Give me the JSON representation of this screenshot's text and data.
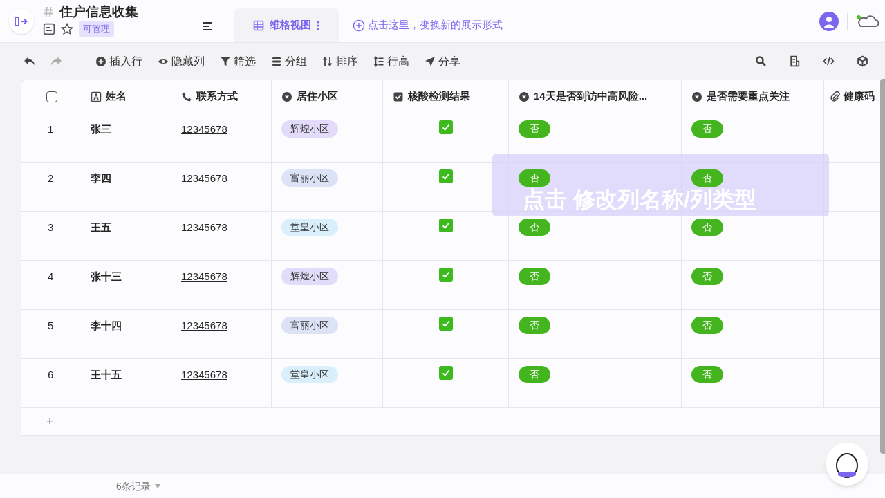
{
  "header": {
    "title": "住户信息收集",
    "permission": "可管理",
    "view_tab": {
      "label": "维格视图",
      "selected": true
    },
    "view_hint": "点击这里，变换新的展示形式"
  },
  "toolbar": [
    "插入行",
    "隐藏列",
    "筛选",
    "分组",
    "排序",
    "行高",
    "分享"
  ],
  "table": {
    "columns": [
      {
        "label": "姓名",
        "kind": "text"
      },
      {
        "label": "联系方式",
        "kind": "phone"
      },
      {
        "label": "居住小区",
        "kind": "select"
      },
      {
        "label": "核酸检测结果",
        "kind": "checkbox"
      },
      {
        "label": "14天是否到访中高风险...",
        "kind": "select"
      },
      {
        "label": "是否需要重点关注",
        "kind": "select"
      },
      {
        "label": "健康码",
        "kind": "attachment"
      }
    ],
    "rows": [
      {
        "index": "1",
        "name": "张三",
        "phone": "12345678",
        "community": {
          "text": "辉煌小区",
          "color": "#e2dcfa"
        },
        "tested": true,
        "visited": {
          "text": "否",
          "color": "#44b51f"
        },
        "focus": {
          "text": "否",
          "color": "#44b51f"
        }
      },
      {
        "index": "2",
        "name": "李四",
        "phone": "12345678",
        "community": {
          "text": "富丽小区",
          "color": "#dde3f7"
        },
        "tested": true,
        "visited": {
          "text": "否",
          "color": "#44b51f"
        },
        "focus": {
          "text": "否",
          "color": "#44b51f"
        }
      },
      {
        "index": "3",
        "name": "王五",
        "phone": "12345678",
        "community": {
          "text": "堂皇小区",
          "color": "#d9effc"
        },
        "tested": true,
        "visited": {
          "text": "否",
          "color": "#44b51f"
        },
        "focus": {
          "text": "否",
          "color": "#44b51f"
        }
      },
      {
        "index": "4",
        "name": "张十三",
        "phone": "12345678",
        "community": {
          "text": "辉煌小区",
          "color": "#e2dcfa"
        },
        "tested": true,
        "visited": {
          "text": "否",
          "color": "#44b51f"
        },
        "focus": {
          "text": "否",
          "color": "#44b51f"
        }
      },
      {
        "index": "5",
        "name": "李十四",
        "phone": "12345678",
        "community": {
          "text": "富丽小区",
          "color": "#dde3f7"
        },
        "tested": true,
        "visited": {
          "text": "否",
          "color": "#44b51f"
        },
        "focus": {
          "text": "否",
          "color": "#44b51f"
        }
      },
      {
        "index": "6",
        "name": "王十五",
        "phone": "12345678",
        "community": {
          "text": "堂皇小区",
          "color": "#d9effc"
        },
        "tested": true,
        "visited": {
          "text": "否",
          "color": "#44b51f"
        },
        "focus": {
          "text": "否",
          "color": "#44b51f"
        }
      }
    ],
    "add_row": "+",
    "all_selected": false
  },
  "tooltip": "点击 修改列名称/列类型",
  "status_bar": {
    "record_count": "6条记录"
  }
}
